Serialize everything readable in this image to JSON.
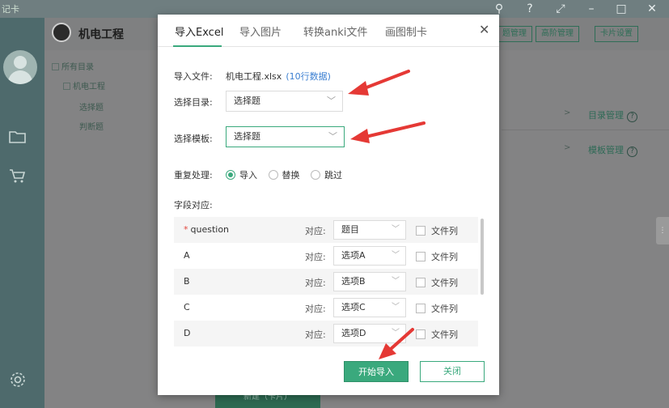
{
  "app": {
    "name": "机电工程",
    "title_mark": "记卡",
    "header_buttons": [
      "题管理",
      "高阶管理",
      "卡片设置"
    ],
    "tree": {
      "root": "所有目录",
      "child": "机电工程",
      "leaves": [
        "选择题",
        "判断题"
      ]
    },
    "side_links": [
      "目录管理",
      "模板管理"
    ],
    "bottom_button": "新建（卡片）"
  },
  "dialog": {
    "tabs": [
      {
        "label": "导入Excel",
        "active": true
      },
      {
        "label": "导入图片",
        "active": false
      },
      {
        "label": "转换anki文件",
        "active": false
      },
      {
        "label": "画图制卡",
        "active": false
      }
    ],
    "file_label": "导入文件:",
    "file_name": "机电工程.xlsx",
    "file_count": "(10行数据)",
    "dir_label": "选择目录:",
    "dir_value": "选择题",
    "tpl_label": "选择模板:",
    "tpl_value": "选择题",
    "dup_label": "重复处理:",
    "dup_options": [
      {
        "label": "导入",
        "selected": true
      },
      {
        "label": "替换",
        "selected": false
      },
      {
        "label": "跳过",
        "selected": false
      }
    ],
    "mapping_label": "字段对应:",
    "corr_label": "对应:",
    "file_col_label": "文件列",
    "rows": [
      {
        "field": "question",
        "required": true,
        "map": "题目"
      },
      {
        "field": "A",
        "required": false,
        "map": "选项A"
      },
      {
        "field": "B",
        "required": false,
        "map": "选项B"
      },
      {
        "field": "C",
        "required": false,
        "map": "选项C"
      },
      {
        "field": "D",
        "required": false,
        "map": "选项D"
      }
    ],
    "start_button": "开始导入",
    "close_button": "关闭"
  },
  "colors": {
    "accent": "#3aa97d",
    "link": "#3b7fd1",
    "annotation": "#e53935"
  }
}
